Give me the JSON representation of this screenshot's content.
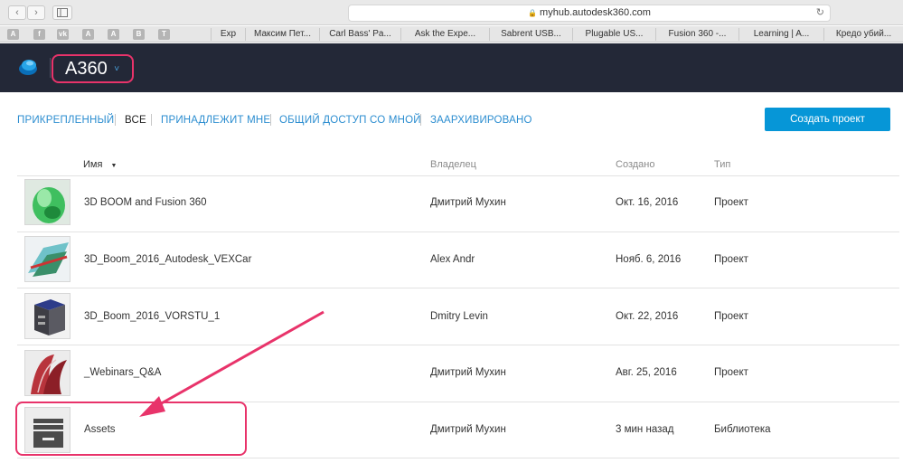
{
  "browser": {
    "back": "‹",
    "forward": "›",
    "url": "myhub.autodesk360.com",
    "lock": "🔒",
    "reload": "↻",
    "bookmarks": [
      "Exp",
      "Максим Пет...",
      "Carl Bass' Pa...",
      "Ask the Expe...",
      "Sabrent USB...",
      "Plugable US...",
      "Fusion 360 -...",
      "Learning | A...",
      "Кредо убий..."
    ],
    "bookmark_icons": [
      "A",
      "f",
      "vk",
      "A",
      "A",
      "B",
      "T"
    ]
  },
  "header": {
    "title": "A360",
    "chevron": "˅"
  },
  "tabs": [
    "ПРИКРЕПЛЕННЫЙ",
    "ВСЕ",
    "ПРИНАДЛЕЖИТ МНЕ",
    "ОБЩИЙ ДОСТУП СО МНОЙ",
    "ЗААРХИВИРОВАНО"
  ],
  "create_button": "Создать проект",
  "columns": {
    "name": "Имя",
    "sort": "▼",
    "owner": "Владелец",
    "created": "Создано",
    "type": "Тип"
  },
  "rows": [
    {
      "name": "3D BOOM and Fusion 360",
      "owner": "Дмитрий Мухин",
      "created": "Окт. 16, 2016",
      "type": "Проект"
    },
    {
      "name": "3D_Boom_2016_Autodesk_VEXCar",
      "owner": "Alex Andr",
      "created": "Нояб. 6, 2016",
      "type": "Проект"
    },
    {
      "name": "3D_Boom_2016_VORSTU_1",
      "owner": "Dmitry Levin",
      "created": "Окт. 22, 2016",
      "type": "Проект"
    },
    {
      "name": "_Webinars_Q&A",
      "owner": "Дмитрий Мухин",
      "created": "Авг. 25, 2016",
      "type": "Проект"
    },
    {
      "name": "Assets",
      "owner": "Дмитрий Мухин",
      "created": "3 мин назад",
      "type": "Библиотека"
    }
  ],
  "colors": {
    "accent": "#0696d7",
    "header_bg": "#232837",
    "highlight": "#e8336a",
    "link": "#2b8dd0"
  }
}
